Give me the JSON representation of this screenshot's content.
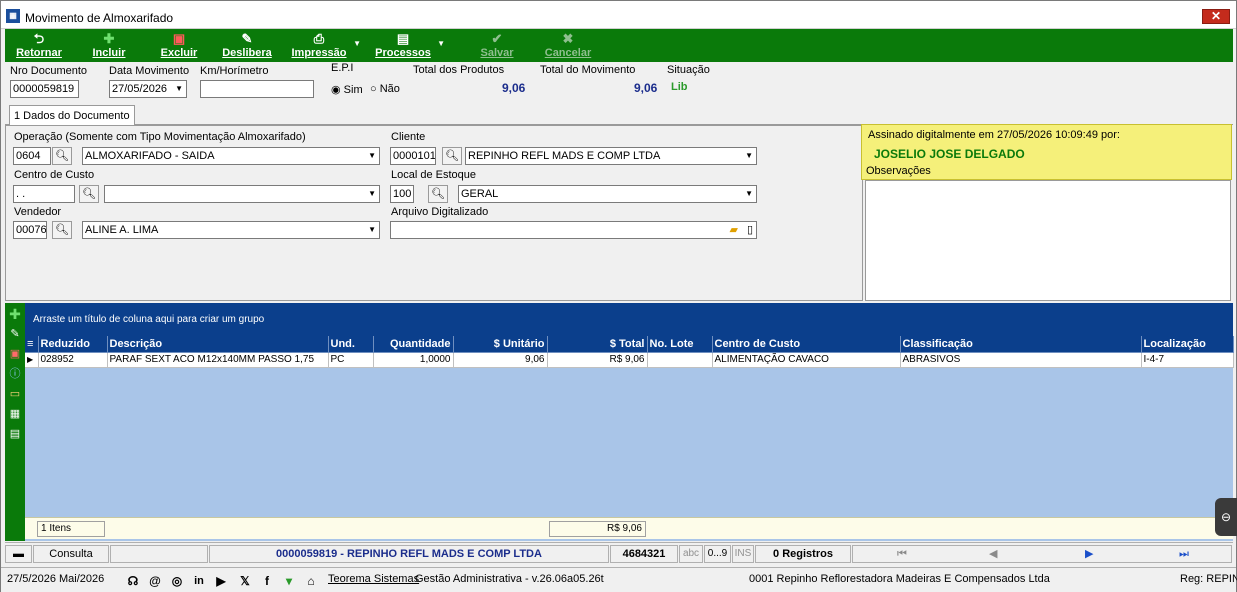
{
  "window": {
    "title": "Movimento de Almoxarifado",
    "close": "✕"
  },
  "toolbar": {
    "retornar": "Retornar",
    "incluir": "Incluir",
    "excluir": "Excluir",
    "deslibera": "Deslibera",
    "impressao": "Impressão",
    "processos": "Processos",
    "salvar": "Salvar",
    "cancelar": "Cancelar"
  },
  "header": {
    "nro_label": "Nro Documento",
    "nro_value": "0000059819",
    "data_label": "Data Movimento",
    "data_value": "27/05/2026",
    "km_label": "Km/Horímetro",
    "km_value": "",
    "epi_label": "E.P.I",
    "epi_sim": "Sim",
    "epi_nao": "Não",
    "total_prod_label": "Total dos Produtos",
    "total_prod_value": "9,06",
    "total_mov_label": "Total do Movimento",
    "total_mov_value": "9,06",
    "situacao_label": "Situação",
    "situacao_value": "Lib"
  },
  "tab": {
    "label": "1 Dados do Documento"
  },
  "form": {
    "operacao_label": "Operação (Somente com Tipo Movimentação Almoxarifado)",
    "operacao_code": "0604",
    "operacao_value": "ALMOXARIFADO - SAIDA",
    "cliente_label": "Cliente",
    "cliente_code": "0000101",
    "cliente_value": "REPINHO REFL MADS E COMP LTDA",
    "centro_label": "Centro de Custo",
    "centro_code": " .  .",
    "centro_value": "",
    "local_label": "Local de Estoque",
    "local_code": "100",
    "local_value": "GERAL",
    "vendedor_label": "Vendedor",
    "vendedor_code": "00076",
    "vendedor_value": "ALINE A. LIMA",
    "arquivo_label": "Arquivo Digitalizado",
    "arquivo_value": ""
  },
  "signature": {
    "text": "Assinado digitalmente em 27/05/2026 10:09:49 por:",
    "name": "JOSELIO JOSE DELGADO",
    "obs_label": "Observações"
  },
  "grid": {
    "group_hint": "Arraste um título de coluna aqui para criar um grupo",
    "columns": [
      "Reduzido",
      "Descrição",
      "Und.",
      "Quantidade",
      "$ Unitário",
      "$ Total",
      "No. Lote",
      "Centro de Custo",
      "Classificação",
      "Localização"
    ],
    "rows": [
      [
        "028952",
        "PARAF SEXT ACO M12x140MM PASSO 1,75",
        "PC",
        "1,0000",
        "9,06",
        "R$ 9,06",
        "",
        "ALIMENTAÇÃO CAVACO",
        "ABRASIVOS",
        "I-4-7"
      ]
    ],
    "footer_count": "1 Itens",
    "footer_total": "R$ 9,06"
  },
  "status": {
    "mode": "Consulta",
    "doc": "0000059819 - REPINHO REFL MADS E COMP LTDA",
    "id": "4684321",
    "abc": "abc",
    "num": "0...9",
    "ins": "INS",
    "registros": "0 Registros"
  },
  "bottom": {
    "date": "27/5/2026 Mai/2026",
    "company_link": "Teorema Sistemas",
    "version": "Gestão Administrativa - v.26.06a05.26t",
    "empresa": "0001 Repinho Reflorestadora Madeiras E Compensados Ltda",
    "reg": "Reg: REPINHO"
  }
}
